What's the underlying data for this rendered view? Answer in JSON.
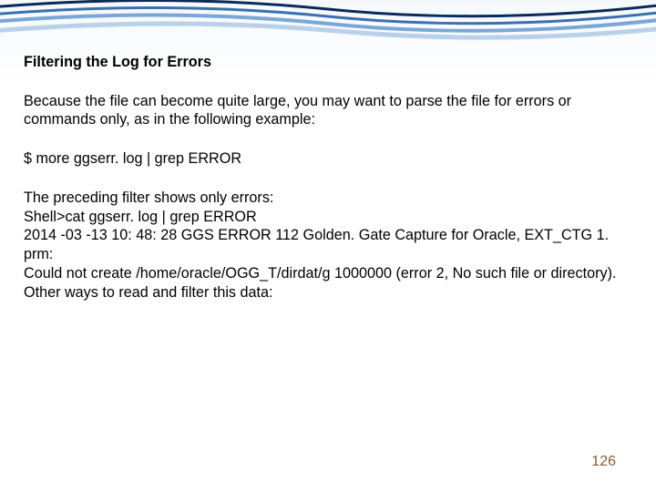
{
  "slide": {
    "heading": "Filtering the Log for Errors",
    "intro": "Because the file can become quite large, you may want to parse the file for errors or commands only, as in the following example:",
    "command": "$ more ggserr. log | grep ERROR",
    "output_block": "The preceding filter shows only errors:\nShell>cat ggserr. log | grep ERROR\n2014 -03 -13 10: 48: 28 GGS ERROR 112 Golden. Gate Capture for Oracle, EXT_CTG 1. prm:\nCould not create /home/oracle/OGG_T/dirdat/g 1000000 (error 2, No such file or directory).\nOther ways to read and filter this data:",
    "page_number": "126"
  },
  "chart_data": null
}
